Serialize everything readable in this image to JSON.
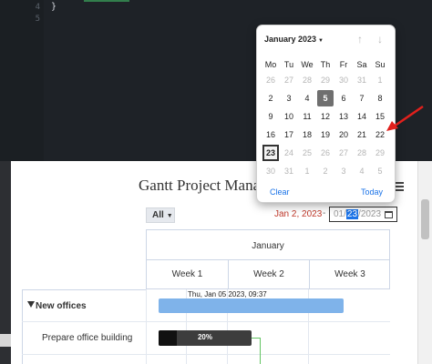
{
  "editor": {
    "lines": [
      {
        "num": "4",
        "code": "}"
      },
      {
        "num": "5",
        "code": ""
      }
    ]
  },
  "gantt": {
    "title": "Gantt Project Manage",
    "filter_value": "All",
    "range_start": "Jan 2, 2023",
    "range_separator": "-",
    "date_input": {
      "month": "01",
      "day": "23",
      "year": "2023"
    },
    "month_header": "January",
    "weeks": [
      "Week 1",
      "Week 2",
      "Week 3"
    ],
    "tasks": [
      {
        "name": "New offices",
        "bar_tooltip": "Thu, Jan 05 2023, 09:37"
      },
      {
        "name": "Prepare office building",
        "progress_label": "20%",
        "progress": 0.2
      }
    ]
  },
  "calendar": {
    "month_label": "January 2023",
    "weekdays": [
      "Mo",
      "Tu",
      "We",
      "Th",
      "Fr",
      "Sa",
      "Su"
    ],
    "weeks": [
      [
        {
          "d": "26",
          "o": true
        },
        {
          "d": "27",
          "o": true
        },
        {
          "d": "28",
          "o": true
        },
        {
          "d": "29",
          "o": true
        },
        {
          "d": "30",
          "o": true
        },
        {
          "d": "31",
          "o": true
        },
        {
          "d": "1",
          "o": true
        }
      ],
      [
        {
          "d": "2"
        },
        {
          "d": "3"
        },
        {
          "d": "4"
        },
        {
          "d": "5",
          "sel": true
        },
        {
          "d": "6"
        },
        {
          "d": "7"
        },
        {
          "d": "8"
        }
      ],
      [
        {
          "d": "9"
        },
        {
          "d": "10"
        },
        {
          "d": "11"
        },
        {
          "d": "12"
        },
        {
          "d": "13"
        },
        {
          "d": "14"
        },
        {
          "d": "15"
        }
      ],
      [
        {
          "d": "16"
        },
        {
          "d": "17"
        },
        {
          "d": "18"
        },
        {
          "d": "19"
        },
        {
          "d": "20"
        },
        {
          "d": "21"
        },
        {
          "d": "22"
        }
      ],
      [
        {
          "d": "23",
          "today": true
        },
        {
          "d": "24",
          "o": true
        },
        {
          "d": "25",
          "o": true
        },
        {
          "d": "26",
          "o": true
        },
        {
          "d": "27",
          "o": true
        },
        {
          "d": "28",
          "o": true
        },
        {
          "d": "29",
          "o": true
        }
      ],
      [
        {
          "d": "30",
          "o": true
        },
        {
          "d": "31",
          "o": true
        },
        {
          "d": "1",
          "o": true
        },
        {
          "d": "2",
          "o": true
        },
        {
          "d": "3",
          "o": true
        },
        {
          "d": "4",
          "o": true
        },
        {
          "d": "5",
          "o": true
        }
      ]
    ],
    "clear_label": "Clear",
    "today_label": "Today"
  },
  "colors": {
    "accent": "#1a73e8",
    "range_start_text": "#c0392b",
    "task_bar": "#7fb3ea",
    "annotation_arrow": "#e0201c"
  }
}
